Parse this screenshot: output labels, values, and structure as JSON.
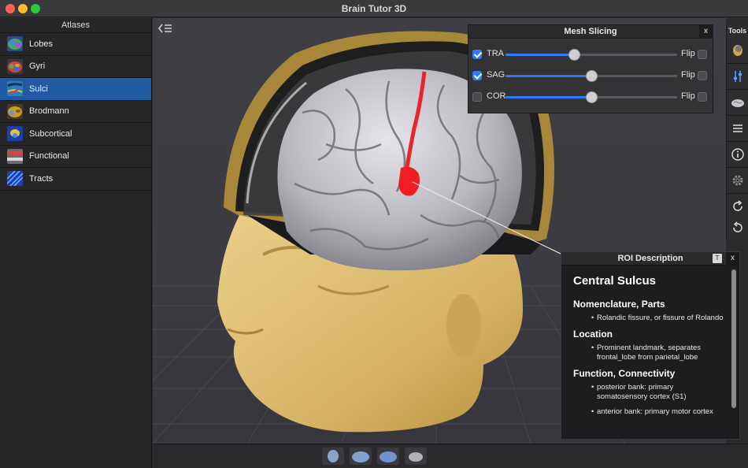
{
  "window": {
    "title": "Brain Tutor 3D"
  },
  "sidebar": {
    "header": "Atlases",
    "items": [
      {
        "label": "Lobes",
        "icon": "lobes-thumb-icon",
        "active": false
      },
      {
        "label": "Gyri",
        "icon": "gyri-thumb-icon",
        "active": false
      },
      {
        "label": "Sulci",
        "icon": "sulci-thumb-icon",
        "active": true
      },
      {
        "label": "Brodmann",
        "icon": "brodmann-thumb-icon",
        "active": false
      },
      {
        "label": "Subcortical",
        "icon": "subcortical-thumb-icon",
        "active": false
      },
      {
        "label": "Functional",
        "icon": "functional-thumb-icon",
        "active": false
      },
      {
        "label": "Tracts",
        "icon": "tracts-thumb-icon",
        "active": false
      }
    ]
  },
  "tools": {
    "title": "Tools",
    "items": [
      "head-icon",
      "sliders-icon",
      "brain-icon",
      "menu-icon",
      "info-icon",
      "gear-icon",
      "rotate-cw-icon",
      "rotate-ccw-icon"
    ]
  },
  "mesh_slicing": {
    "title": "Mesh Slicing",
    "close": "x",
    "flip_label": "Flip",
    "rows": [
      {
        "label": "TRA",
        "enabled": true,
        "value": 0.4
      },
      {
        "label": "SAG",
        "enabled": true,
        "value": 0.5
      },
      {
        "label": "COR",
        "enabled": false,
        "value": 0.5
      }
    ]
  },
  "roi": {
    "title": "ROI Description",
    "toggle": "T",
    "close": "x",
    "name": "Central Sulcus",
    "sections": [
      {
        "heading": "Nomenclature, Parts",
        "items": [
          "Rolandic fissure, or fissure of Rolando"
        ]
      },
      {
        "heading": "Location",
        "items": [
          "Prominent landmark, separates frontal_lobe from parietal_lobe"
        ]
      },
      {
        "heading": "Function, Connectivity",
        "items": [
          "posterior bank: primary somatosensory cortex (S1)",
          "anterior bank: primary motor cortex"
        ]
      }
    ]
  },
  "colors": {
    "accent": "#2d7cf6",
    "selection": "#1f5aa3",
    "highlight": "#e8262a",
    "skin": "#d9b86a"
  }
}
